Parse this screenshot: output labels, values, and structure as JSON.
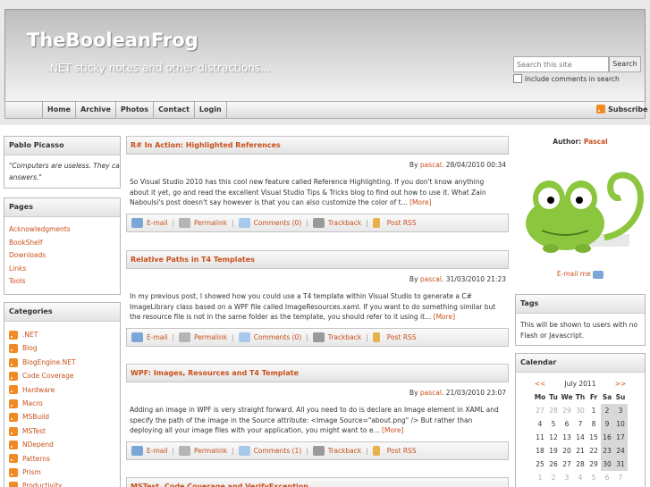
{
  "site": {
    "title": "TheBooleanFrog",
    "tagline": ".NET sticky notes and other distractions...",
    "search_placeholder": "Search this site",
    "search_button": "Search",
    "include_comments": "Include comments in search"
  },
  "nav": [
    "Home",
    "Archive",
    "Photos",
    "Contact",
    "Login"
  ],
  "subscribe": "Subscribe",
  "left": {
    "author_box": {
      "name": "Pablo Picasso",
      "quote": "\"Computers are useless. They can only give you answers.\""
    },
    "pages": {
      "title": "Pages",
      "items": [
        "Acknowledgments",
        "BookShelf",
        "Downloads",
        "Links",
        "Tools"
      ]
    },
    "categories": {
      "title": "Categories",
      "items": [
        ".NET",
        "Blog",
        "BlogEngine.NET",
        "Code Coverage",
        "Hardware",
        "Macro",
        "MSBuild",
        "MSTest",
        "NDepend",
        "Patterns",
        "Prism",
        "Productivity"
      ]
    }
  },
  "posts": [
    {
      "title": "R# In Action: Highlighted References",
      "by": "By",
      "author": "pascal",
      "date": "28/04/2010 00:34",
      "body": "So Visual Studio 2010 has this cool new feature called Reference Highlighting. If you don't know anything about it yet, go and read the excellent Visual Studio Tips & Tricks blog to find out how to use it. What Zain Naboulsi's post doesn't say however is that you can also customize the color of t...",
      "more": "[More]",
      "comments": "Comments (0)"
    },
    {
      "title": "Relative Paths in T4 Templates",
      "by": "By",
      "author": "pascal",
      "date": "31/03/2010 21:23",
      "body": "In my previous post, I showed how you could use a T4 template within Visual Studio to generate a C# ImageLibrary class based on a WPF file called ImageResources.xaml. If you want to do something similar but the resource file is not in the same folder as the template, you should refer to it using it...",
      "more": "[More]",
      "comments": "Comments (0)"
    },
    {
      "title": "WPF: Images, Resources and T4 Template",
      "by": "By",
      "author": "pascal",
      "date": "21/03/2010 23:07",
      "body": "Adding an image in WPF is very straight forward. All you need to do is declare an Image element in XAML and specify the path of the image in the Source attribute: <Image Source=\"about.png\" /> But rather than deploying all your image files with your application, you might want to e...",
      "more": "[More]",
      "comments": "Comments (1)"
    },
    {
      "title": "MSTest, Code Coverage and VerifyException"
    }
  ],
  "post_actions": {
    "email": "E-mail",
    "permalink": "Permalink",
    "trackback": "Trackback",
    "rss": "Post RSS"
  },
  "right": {
    "author_label": "Author:",
    "author_name": "Pascal",
    "email_me": "E-mail me",
    "tags": {
      "title": "Tags",
      "text": "This will be shown to users with no Flash or Javascript."
    },
    "calendar": {
      "title": "Calendar",
      "prev": "<<",
      "next": ">>",
      "month": "July 2011",
      "days": [
        "Mo",
        "Tu",
        "We",
        "Th",
        "Fr",
        "Sa",
        "Su"
      ],
      "weeks": [
        [
          "27",
          "28",
          "29",
          "30",
          "1",
          "2",
          "3"
        ],
        [
          "4",
          "5",
          "6",
          "7",
          "8",
          "9",
          "10"
        ],
        [
          "11",
          "12",
          "13",
          "14",
          "15",
          "16",
          "17"
        ],
        [
          "18",
          "19",
          "20",
          "21",
          "22",
          "23",
          "24"
        ],
        [
          "25",
          "26",
          "27",
          "28",
          "29",
          "30",
          "31"
        ],
        [
          "1",
          "2",
          "3",
          "4",
          "5",
          "6",
          "7"
        ]
      ]
    }
  },
  "colors": {
    "link": "#c8501a",
    "rss": "#f08a24",
    "frog": "#8cc63f"
  }
}
